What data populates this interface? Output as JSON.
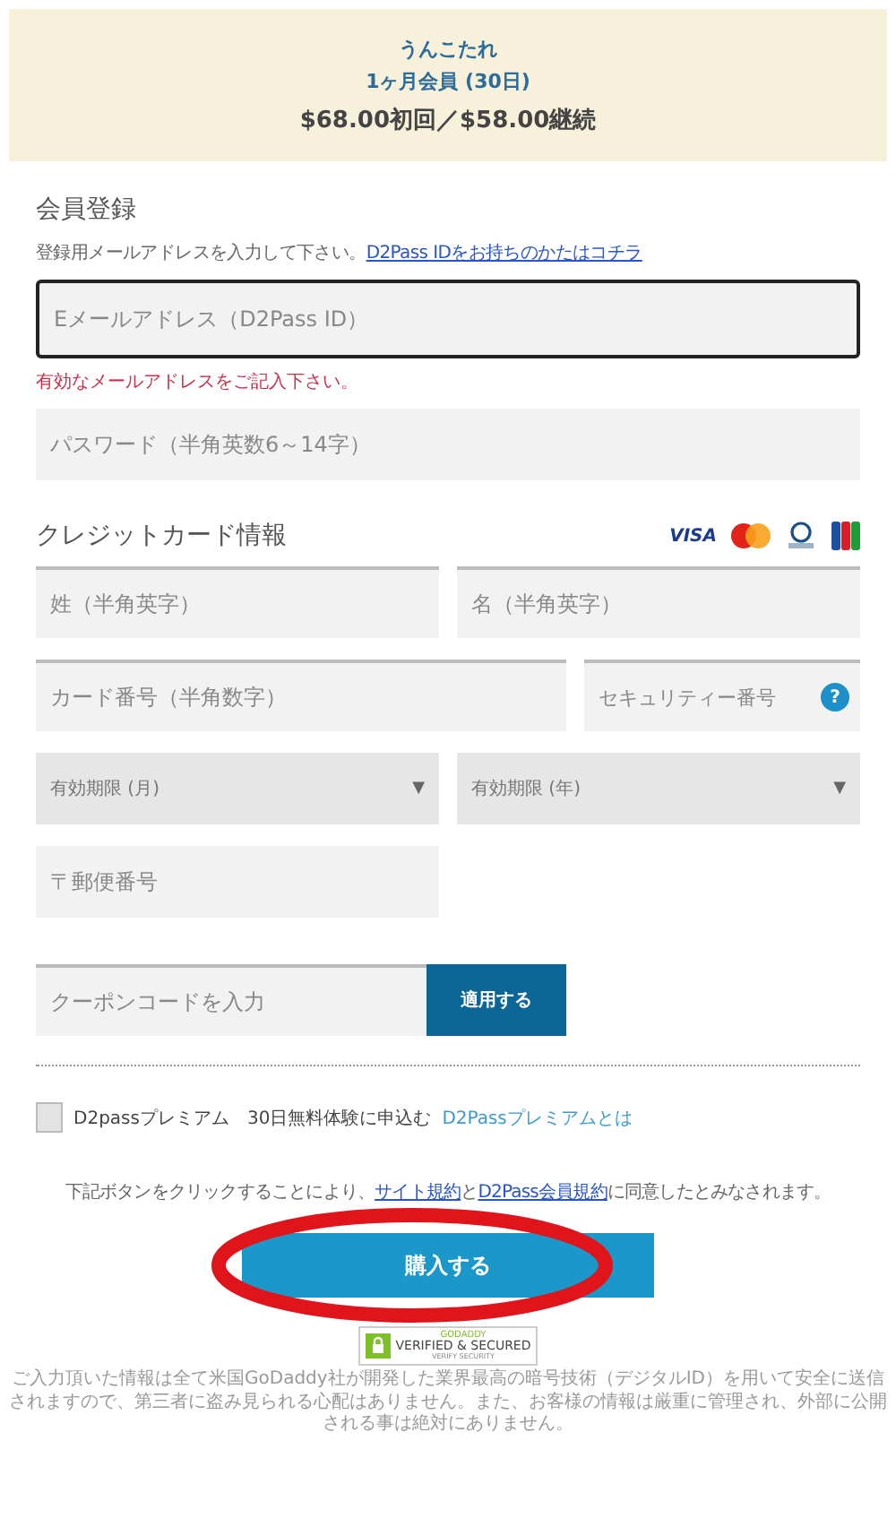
{
  "plan": {
    "name": "うんこたれ",
    "term": "1ヶ月会員 (30日)",
    "price": "$68.00初回／$58.00継続"
  },
  "registration": {
    "heading": "会員登録",
    "hint": "登録用メールアドレスを入力して下さい。",
    "hint_link": "D2Pass IDをお持ちのかたはコチラ",
    "email": {
      "placeholder": "Eメールアドレス（D2Pass ID）",
      "focused": true
    },
    "error": "有効なメールアドレスをご記入下さい。",
    "password": {
      "placeholder": "パスワード（半角英数6～14字）"
    }
  },
  "card": {
    "heading": "クレジットカード情報",
    "brands": [
      {
        "kind": "visa",
        "label": "VISA"
      },
      {
        "kind": "mastercard"
      },
      {
        "kind": "diners"
      },
      {
        "kind": "jcb"
      }
    ],
    "last_name": {
      "placeholder": "姓（半角英字）"
    },
    "first_name": {
      "placeholder": "名（半角英字）"
    },
    "number": {
      "placeholder": "カード番号（半角数字）"
    },
    "security": {
      "placeholder": "セキュリティー番号",
      "help": "?"
    },
    "expiry_month": {
      "placeholder": "有効期限 (月)",
      "caret": "▼"
    },
    "expiry_year": {
      "placeholder": "有効期限 (年)",
      "caret": "▼"
    },
    "postal": {
      "placeholder": "〒郵便番号"
    }
  },
  "coupon": {
    "placeholder": "クーポンコードを入力",
    "button": "適用する"
  },
  "premium": {
    "checked": false,
    "label": "D2passプレミアム　30日無料体験に申込む",
    "link": "D2Passプレミアムとは"
  },
  "agreement": {
    "before": "下記ボタンをクリックすることにより、",
    "link1": "サイト規約",
    "middle": "と",
    "link2": "D2Pass会員規約",
    "after": "に同意したとみなされます。"
  },
  "purchase": {
    "label": "購入する",
    "highlighted": true
  },
  "badge": {
    "top": "GODADDY",
    "label": "VERIFIED & SECURED",
    "bottom": "VERIFY SECURITY"
  },
  "footer": "ご入力頂いた情報は全て米国GoDaddy社が開発した業界最高の暗号技術（デジタルID）を用いて安全に送信されますので、第三者に盗み見られる心配はありません。また、お客様の情報は厳重に管理され、外部に公開される事は絶対にありません。"
}
